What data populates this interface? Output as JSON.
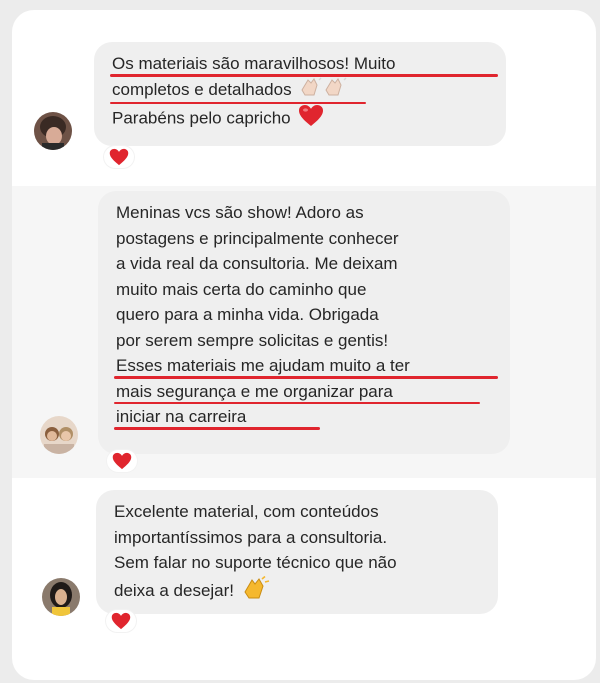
{
  "comments": [
    {
      "lines": [
        {
          "text": "Os materiais são maravilhosos! Muito",
          "underline": true
        },
        {
          "text": "completos e detalhados",
          "underline": true,
          "emoji": "clapping-hands-icon"
        },
        {
          "text": "Parabéns pelo capricho",
          "underline": false,
          "emoji": "red-heart-icon"
        }
      ],
      "reaction": "red-heart-icon"
    },
    {
      "lines": [
        {
          "text": "Meninas vcs são show! Adoro  as",
          "underline": false
        },
        {
          "text": "postagens e principalmente conhecer",
          "underline": false
        },
        {
          "text": "a vida real da consultoria. Me deixam",
          "underline": false
        },
        {
          "text": "muito mais certa do caminho que",
          "underline": false
        },
        {
          "text": "quero para a minha vida. Obrigada",
          "underline": false
        },
        {
          "text": "por serem sempre solicitas e gentis!",
          "underline": false
        },
        {
          "text": "Esses materiais me ajudam muito a ter",
          "underline": true
        },
        {
          "text": "mais segurança e me organizar para",
          "underline": true
        },
        {
          "text": "iniciar na carreira",
          "underline": true
        }
      ],
      "reaction": "red-heart-icon"
    },
    {
      "lines": [
        {
          "text": "Excelente material, com conteúdos",
          "underline": false
        },
        {
          "text": "importantíssimos para a consultoria.",
          "underline": false
        },
        {
          "text": "Sem falar no suporte técnico que não",
          "underline": false
        },
        {
          "text": "deixa a desejar!",
          "underline": false,
          "emoji": "clapping-hands-icon"
        }
      ],
      "reaction": "red-heart-icon"
    }
  ],
  "colors": {
    "bubble": "#efefef",
    "text": "#262626",
    "underline": "#e0252e",
    "heart": "#e0252e"
  }
}
